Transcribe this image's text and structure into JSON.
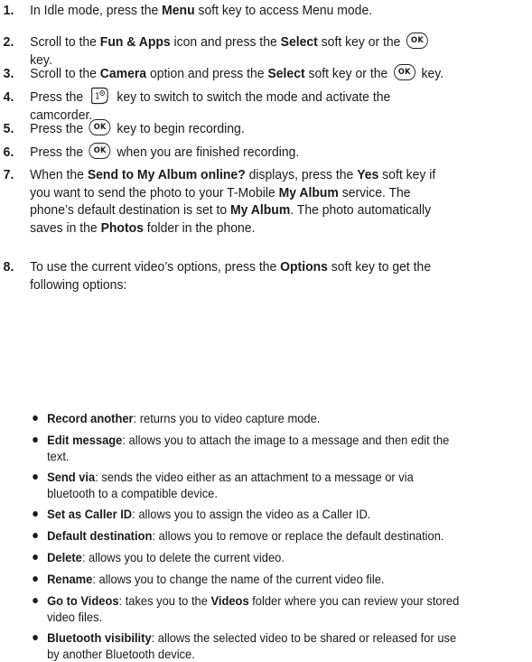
{
  "steps": [
    {
      "num": "1.",
      "parts": [
        {
          "t": "In Idle mode, press the "
        },
        {
          "b": "Menu"
        },
        {
          "t": " soft key to access Menu mode."
        }
      ]
    },
    {
      "num": "2.",
      "lines": [
        [
          {
            "t": "Scroll to the "
          },
          {
            "b": "Fun & Apps"
          },
          {
            "t": " icon and press the "
          },
          {
            "b": "Select"
          },
          {
            "t": " soft key or the "
          },
          {
            "icon": "ok",
            "label": "OK"
          }
        ],
        [
          {
            "t": "key."
          }
        ]
      ]
    },
    {
      "num": "3.",
      "parts": [
        {
          "t": "Scroll to the "
        },
        {
          "b": "Camera"
        },
        {
          "t": " option and press the "
        },
        {
          "b": "Select"
        },
        {
          "t": " soft key or the "
        },
        {
          "icon": "ok",
          "label": "OK"
        },
        {
          "t": " key."
        }
      ]
    },
    {
      "num": "4.",
      "lines": [
        [
          {
            "t": "Press the "
          },
          {
            "icon": "one",
            "label": "1"
          },
          {
            "t": " key to switch to switch the mode and activate the"
          }
        ],
        [
          {
            "t": "camcorder."
          }
        ]
      ]
    },
    {
      "num": "5.",
      "parts": [
        {
          "t": "Press the "
        },
        {
          "icon": "ok",
          "label": "OK"
        },
        {
          "t": " key to begin recording."
        }
      ]
    },
    {
      "num": "6.",
      "parts": [
        {
          "t": "Press the "
        },
        {
          "icon": "ok",
          "label": "OK"
        },
        {
          "t": " when you are finished recording."
        }
      ]
    },
    {
      "num": "7.",
      "lines": [
        [
          {
            "t": "When the "
          },
          {
            "b": "Send to My Album online?"
          },
          {
            "t": " displays, press the "
          },
          {
            "b": "Yes"
          },
          {
            "t": " soft key if"
          }
        ],
        [
          {
            "t": "you want to send the photo to your T-Mobile "
          },
          {
            "b": "My Album"
          },
          {
            "t": " service. The"
          }
        ],
        [
          {
            "t": "phone’s default destination is set to "
          },
          {
            "b": "My Album"
          },
          {
            "t": ". The photo automatically"
          }
        ],
        [
          {
            "t": "saves in the "
          },
          {
            "b": "Photos"
          },
          {
            "t": " folder in the phone."
          }
        ]
      ]
    },
    {
      "num": "8.",
      "lines": [
        [
          {
            "t": "To use the current video’s options, press the "
          },
          {
            "b": "Options"
          },
          {
            "t": " soft key to get the"
          }
        ],
        [
          {
            "t": "following options:"
          }
        ]
      ]
    }
  ],
  "options": [
    {
      "lines": [
        [
          {
            "b": "Record another"
          },
          {
            "t": ": returns you to video capture mode."
          }
        ]
      ]
    },
    {
      "lines": [
        [
          {
            "b": "Edit message"
          },
          {
            "t": ": allows you to attach the image to a message and then edit the"
          }
        ],
        [
          {
            "t": "text."
          }
        ]
      ]
    },
    {
      "lines": [
        [
          {
            "b": "Send via"
          },
          {
            "t": ": sends the video either as an attachment to a message or via"
          }
        ],
        [
          {
            "t": "bluetooth to a compatible device."
          }
        ]
      ]
    },
    {
      "lines": [
        [
          {
            "b": "Set as Caller ID"
          },
          {
            "t": ": allows you to assign the video as a Caller ID."
          }
        ]
      ]
    },
    {
      "lines": [
        [
          {
            "b": "Default destination"
          },
          {
            "t": ": allows you to remove or replace the default destination."
          }
        ]
      ]
    },
    {
      "lines": [
        [
          {
            "b": "Delete"
          },
          {
            "t": ": allows you to delete the current video."
          }
        ]
      ]
    },
    {
      "lines": [
        [
          {
            "b": "Rename"
          },
          {
            "t": ": allows you to change the name of the current video file."
          }
        ]
      ]
    },
    {
      "lines": [
        [
          {
            "b": "Go to Videos"
          },
          {
            "t": ": takes you to the "
          },
          {
            "b": "Videos"
          },
          {
            "t": " folder where you can review your stored"
          }
        ],
        [
          {
            "t": "video files."
          }
        ]
      ]
    },
    {
      "lines": [
        [
          {
            "b": "Bluetooth visibility"
          },
          {
            "t": ": allows the selected video to be shared or released for use"
          }
        ],
        [
          {
            "t": "by another Bluetooth device."
          }
        ]
      ]
    }
  ]
}
